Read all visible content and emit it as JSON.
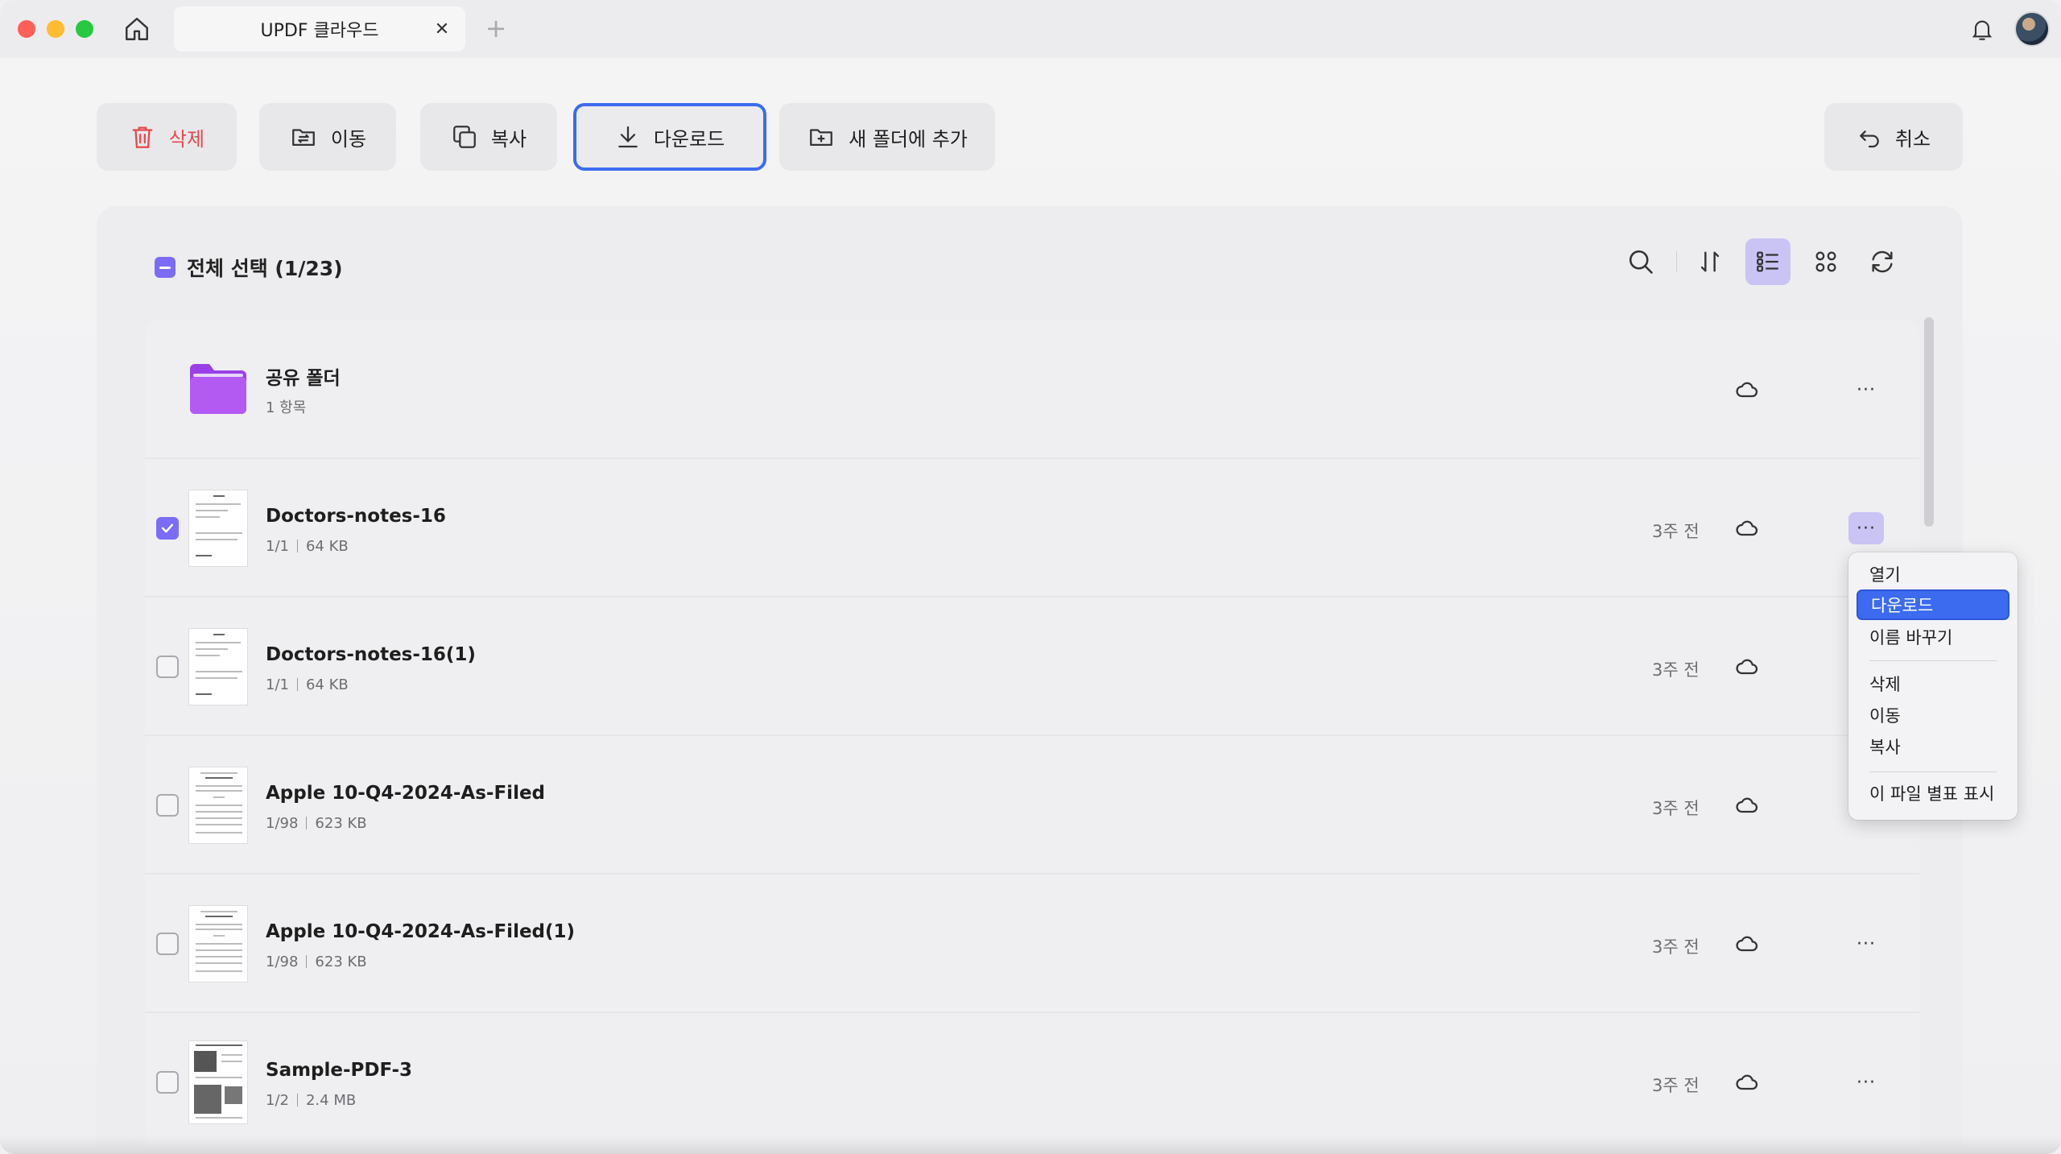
{
  "app": {
    "tab_title": "UPDF 클라우드",
    "tab_close": "✕",
    "tab_add": "+"
  },
  "toolbar": {
    "delete": "삭제",
    "move": "이동",
    "copy": "복사",
    "download": "다운로드",
    "add_to_new_folder": "새 폴더에 추가",
    "cancel": "취소"
  },
  "selection": {
    "label": "전체 선택 (1/23)"
  },
  "files": [
    {
      "name": "공유 폴더",
      "meta": "1 항목",
      "type": "folder",
      "date": "",
      "checked": false
    },
    {
      "name": "Doctors-notes-16",
      "pages": "1/1",
      "size": "64 KB",
      "date": "3주 전",
      "checked": true
    },
    {
      "name": "Doctors-notes-16(1)",
      "pages": "1/1",
      "size": "64 KB",
      "date": "3주 전",
      "checked": false
    },
    {
      "name": "Apple 10-Q4-2024-As-Filed",
      "pages": "1/98",
      "size": "623 KB",
      "date": "3주 전",
      "checked": false
    },
    {
      "name": "Apple 10-Q4-2024-As-Filed(1)",
      "pages": "1/98",
      "size": "623 KB",
      "date": "3주 전",
      "checked": false
    },
    {
      "name": "Sample-PDF-3",
      "pages": "1/2",
      "size": "2.4 MB",
      "date": "3주 전",
      "checked": false
    }
  ],
  "more_label": "···",
  "context_menu": {
    "items": [
      "열기",
      "다운로드",
      "이름 바꾸기",
      "삭제",
      "이동",
      "복사",
      "이 파일 별표 표시"
    ],
    "highlighted": "다운로드"
  },
  "colors": {
    "accent": "#7b6cf6",
    "highlight": "#3c6bf0",
    "danger": "#e5484d",
    "folder": "#a445ec"
  }
}
